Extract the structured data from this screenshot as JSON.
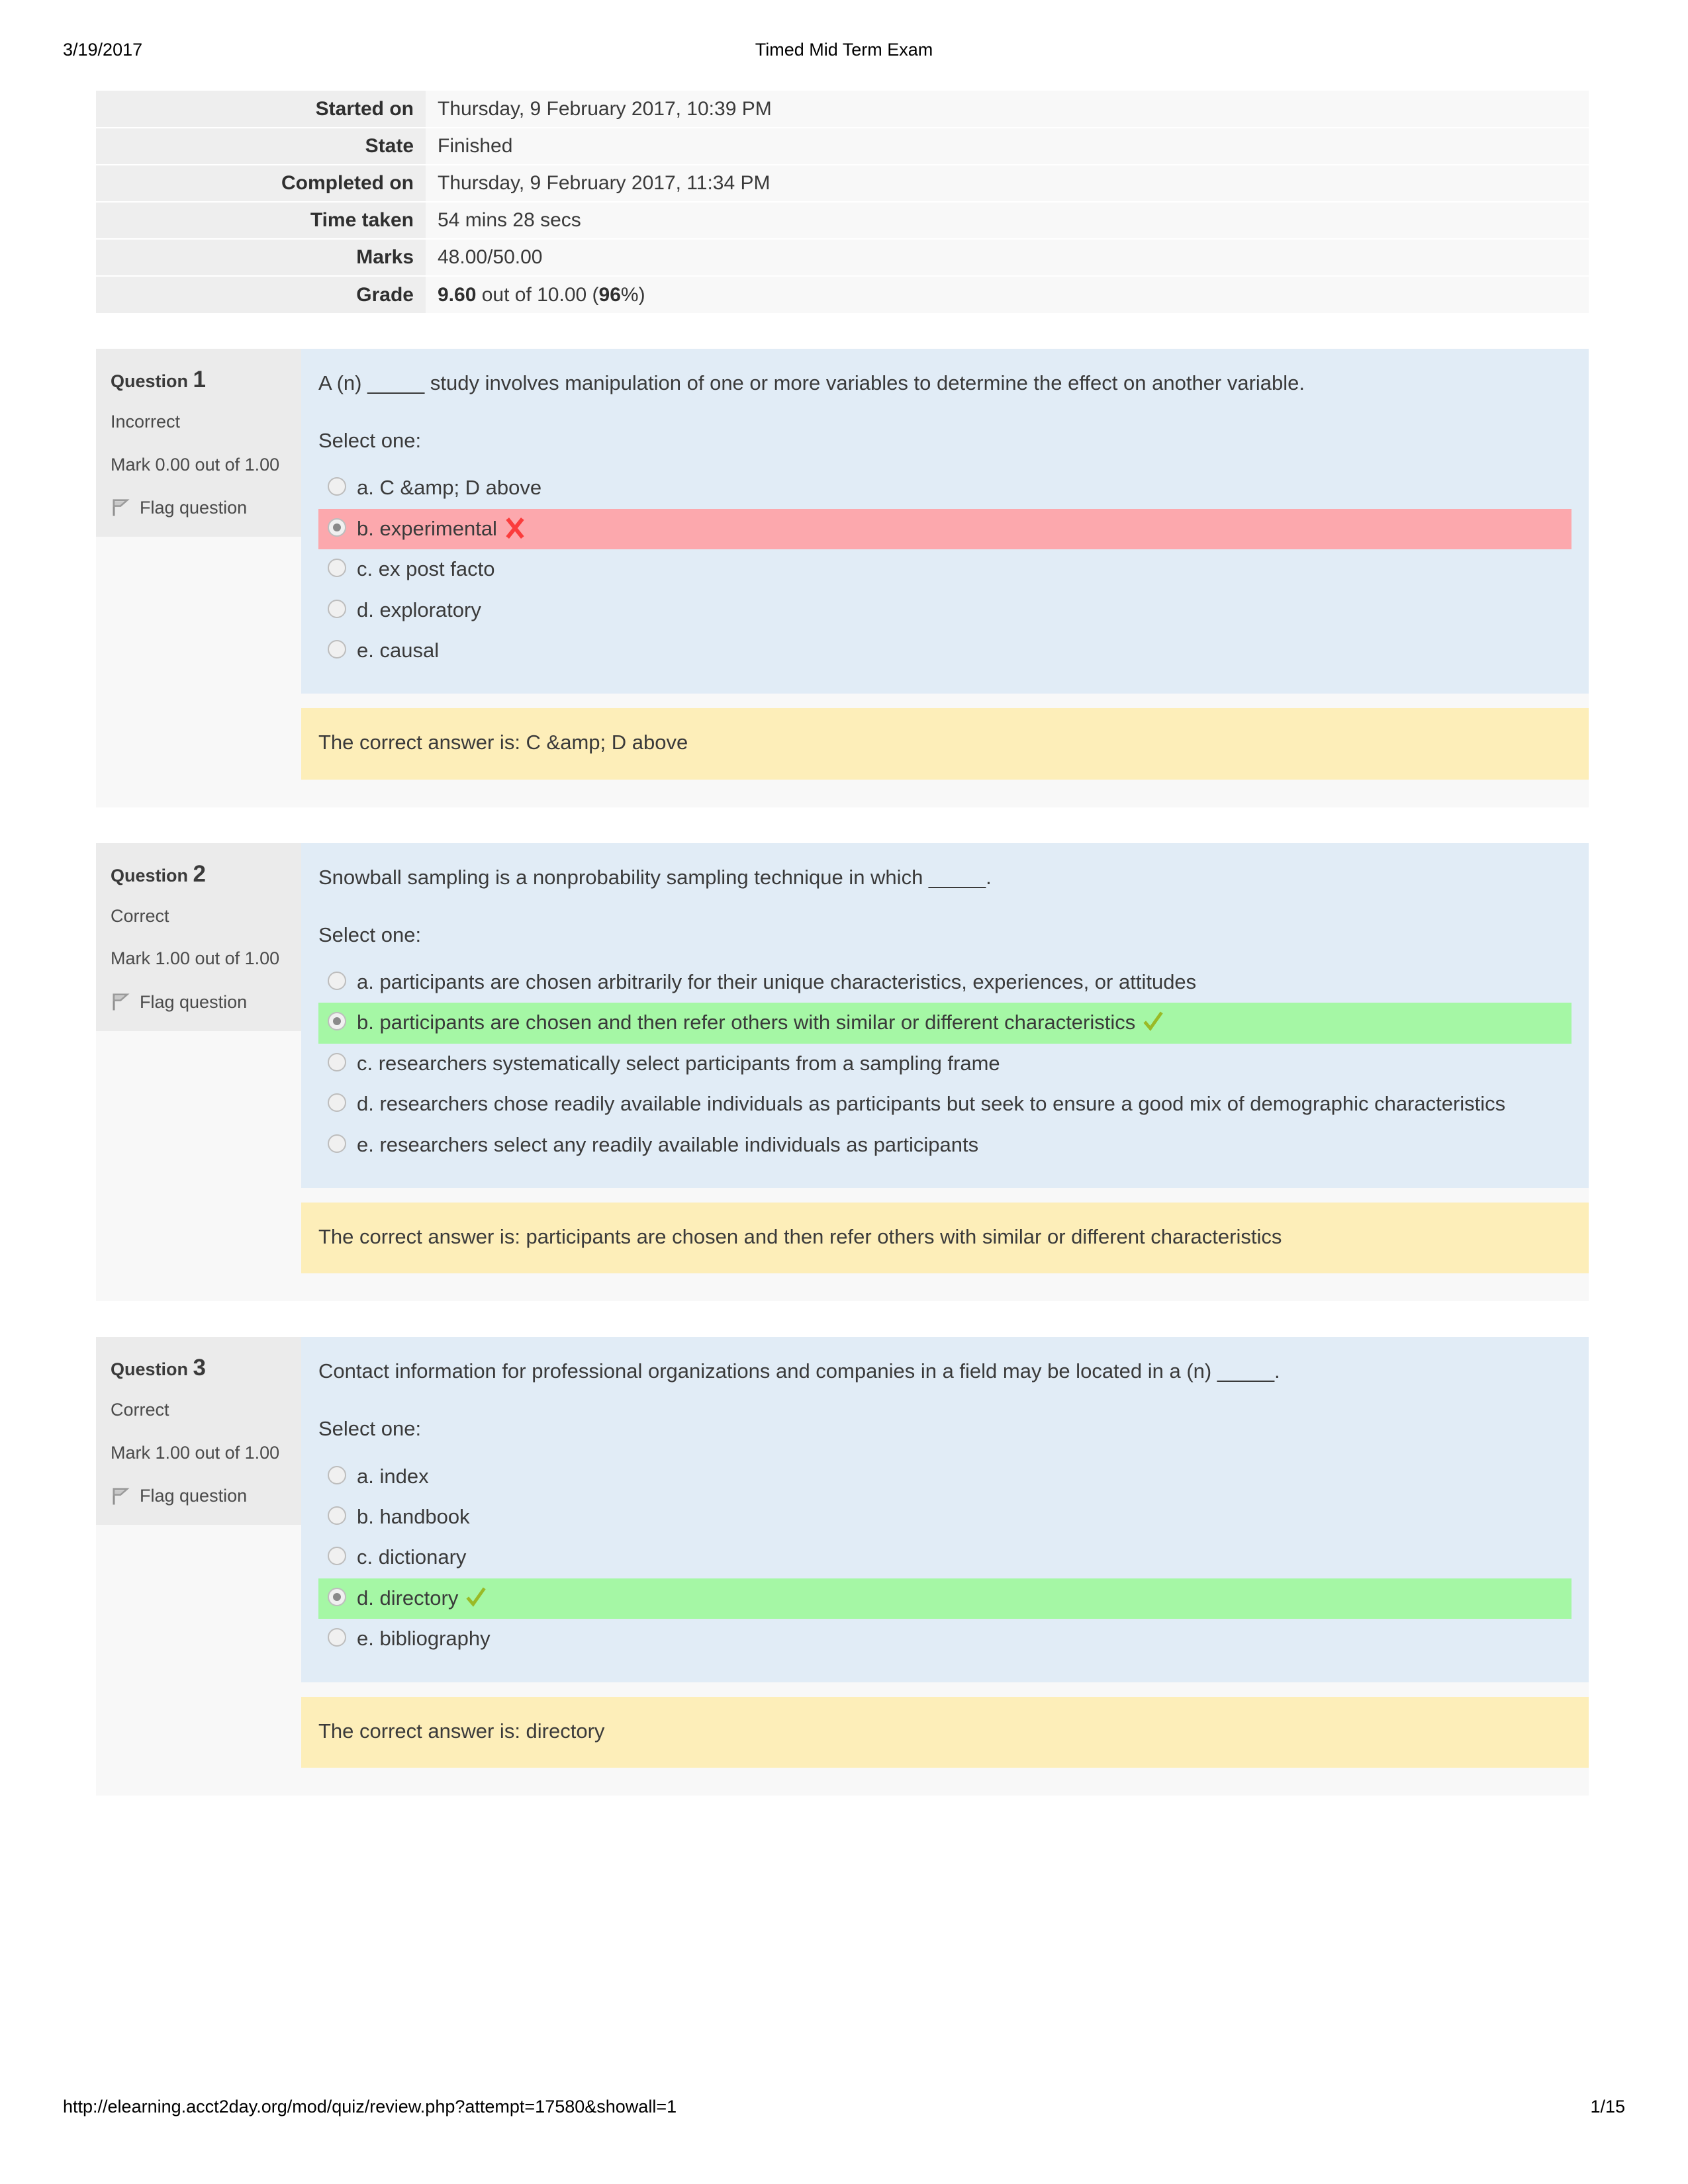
{
  "print_header": {
    "date": "3/19/2017",
    "title": "Timed Mid Term Exam"
  },
  "print_footer": {
    "url": "http://elearning.acct2day.org/mod/quiz/review.php?attempt=17580&showall=1",
    "page": "1/15"
  },
  "summary": {
    "rows": [
      {
        "label": "Started on",
        "value": "Thursday, 9 February 2017, 10:39 PM"
      },
      {
        "label": "State",
        "value": "Finished"
      },
      {
        "label": "Completed on",
        "value": "Thursday, 9 February 2017, 11:34 PM"
      },
      {
        "label": "Time taken",
        "value": "54 mins 28 secs"
      },
      {
        "label": "Marks",
        "value": "48.00/50.00"
      }
    ],
    "grade": {
      "label": "Grade",
      "score": "9.60",
      "middle": " out of 10.00 (",
      "percent": "96",
      "suffix": "%)"
    }
  },
  "labels": {
    "question_word": "Question",
    "select_one": "Select one:",
    "flag_question": "Flag question",
    "flag_icon": "flag-icon",
    "correct_icon": "check-mark-icon",
    "incorrect_icon": "cross-mark-icon"
  },
  "colors": {
    "question_bg": "#e1ecf6",
    "correct_bg": "#a5f7a5",
    "incorrect_bg": "#fca8ad",
    "feedback_bg": "#fdeeb9",
    "info_bg": "#ebebeb",
    "check_mark": "#9aba26",
    "cross_mark": "#fb3c3c"
  },
  "questions": [
    {
      "number": "1",
      "state": "Incorrect",
      "mark": "Mark 0.00 out of 1.00",
      "text": "A (n) _____ study involves manipulation of one or more variables to determine the effect on another variable.",
      "options": [
        {
          "label": "a. C &amp; D above",
          "selected": false,
          "status": "none"
        },
        {
          "label": "b. experimental",
          "selected": true,
          "status": "incorrect"
        },
        {
          "label": "c. ex post facto",
          "selected": false,
          "status": "none"
        },
        {
          "label": "d. exploratory",
          "selected": false,
          "status": "none"
        },
        {
          "label": "e. causal",
          "selected": false,
          "status": "none"
        }
      ],
      "feedback": "The correct answer is: C &amp; D above"
    },
    {
      "number": "2",
      "state": "Correct",
      "mark": "Mark 1.00 out of 1.00",
      "text": "Snowball sampling is a nonprobability sampling technique in which _____.",
      "options": [
        {
          "label": "a. participants are chosen arbitrarily for their unique characteristics, experiences, or attitudes",
          "selected": false,
          "status": "none"
        },
        {
          "label": "b. participants are chosen and then refer others with similar or different characteristics",
          "selected": true,
          "status": "correct"
        },
        {
          "label": "c. researchers systematically select participants from a sampling frame",
          "selected": false,
          "status": "none"
        },
        {
          "label": "d. researchers chose readily available individuals as participants but seek to ensure a good mix of demographic characteristics",
          "selected": false,
          "status": "none"
        },
        {
          "label": "e. researchers select any readily available individuals as participants",
          "selected": false,
          "status": "none"
        }
      ],
      "feedback": "The correct answer is: participants are chosen and then refer others with similar or different characteristics"
    },
    {
      "number": "3",
      "state": "Correct",
      "mark": "Mark 1.00 out of 1.00",
      "text": "Contact information for professional organizations and companies in a field may be located in a (n) _____.",
      "options": [
        {
          "label": "a. index",
          "selected": false,
          "status": "none"
        },
        {
          "label": "b. handbook",
          "selected": false,
          "status": "none"
        },
        {
          "label": "c. dictionary",
          "selected": false,
          "status": "none"
        },
        {
          "label": "d. directory",
          "selected": true,
          "status": "correct"
        },
        {
          "label": "e. bibliography",
          "selected": false,
          "status": "none"
        }
      ],
      "feedback": "The correct answer is: directory"
    }
  ]
}
